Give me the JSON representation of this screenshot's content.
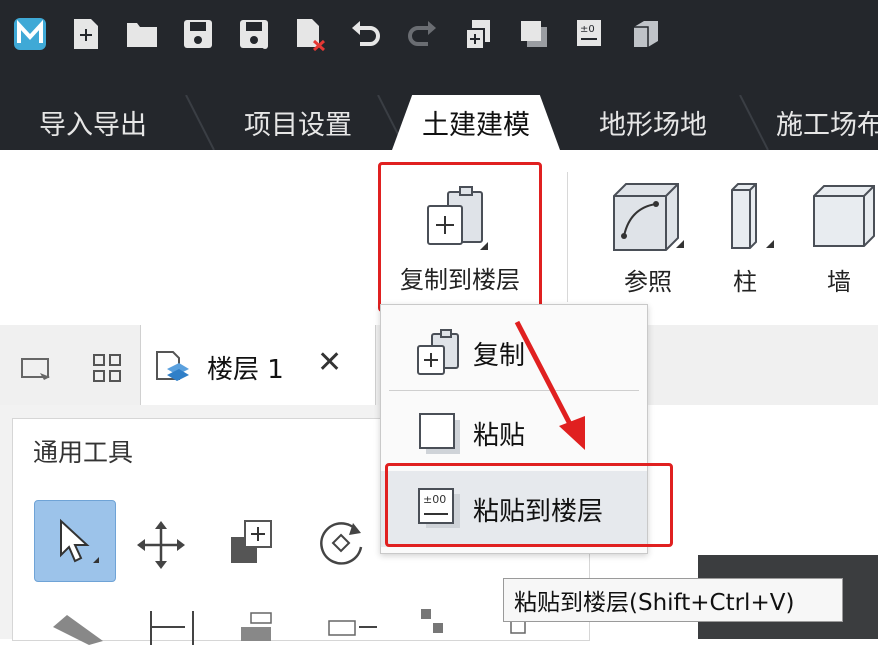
{
  "titlebar": {
    "icons": [
      "app-logo-icon",
      "new-file-icon",
      "open-folder-icon",
      "save-icon",
      "save-as-icon",
      "close-file-icon",
      "undo-icon",
      "redo-icon",
      "copy-to-floor-icon",
      "copy-icon",
      "paste-to-floor-icon",
      "cube-icon"
    ]
  },
  "tabs": [
    {
      "label": "导入导出",
      "active": false
    },
    {
      "label": "项目设置",
      "active": false
    },
    {
      "label": "土建建模",
      "active": true
    },
    {
      "label": "地形场地",
      "active": false
    },
    {
      "label": "施工场布",
      "active": false
    }
  ],
  "ribbon": {
    "copy_to_floor": "复制到楼层",
    "reference": "参照",
    "column": "柱",
    "wall": "墙"
  },
  "panel": {
    "floor_tab": "楼层 1",
    "close": "✕",
    "tools_title": "通用工具"
  },
  "dropdown": {
    "items": [
      {
        "label": "复制"
      },
      {
        "label": "粘贴"
      },
      {
        "label": "粘贴到楼层"
      }
    ]
  },
  "tooltip": "粘贴到楼层(Shift+Ctrl+V)",
  "colors": {
    "accent": "#e02020",
    "highlight": "#9cc3ea",
    "titlebar": "#24272c"
  }
}
